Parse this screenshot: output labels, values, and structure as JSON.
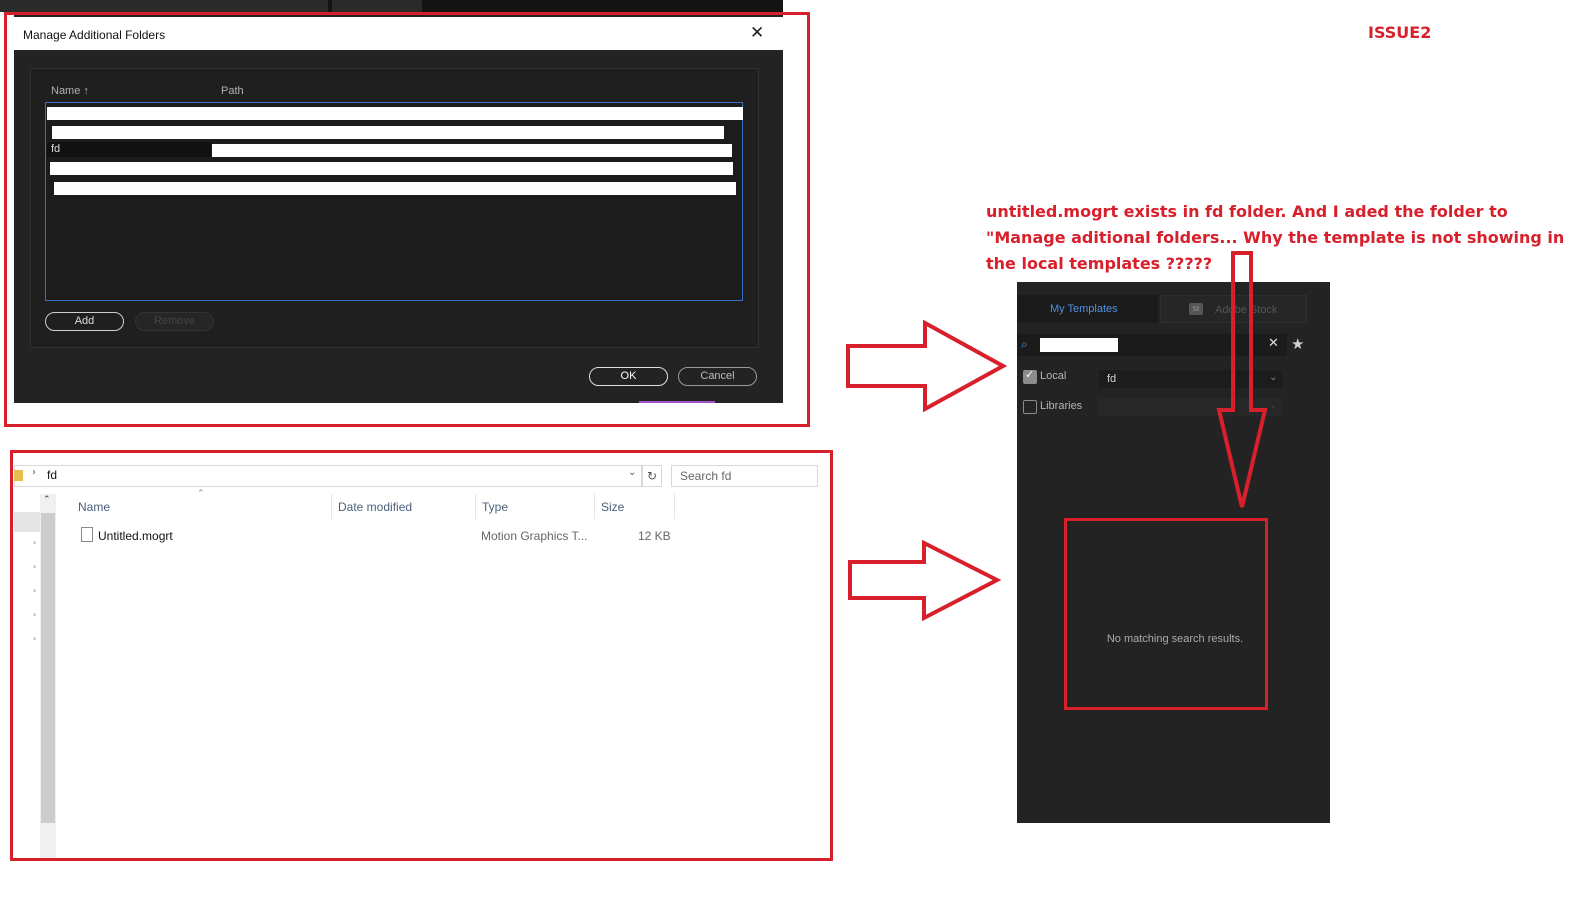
{
  "issue_label": "ISSUE2",
  "annotation_text": {
    "line1": "untitled.mogrt exists in fd folder. And I aded the folder to",
    "line2": "\"Manage aditional folders...  Why the template is not showing in",
    "line3": "the local templates ?????"
  },
  "dialog": {
    "title": "Manage Additional Folders",
    "close_label": "✕",
    "columns": {
      "name": "Name ↑",
      "path": "Path"
    },
    "selected_row_name": "fd",
    "add_label": "Add",
    "remove_label": "Remove",
    "ok_label": "OK",
    "cancel_label": "Cancel"
  },
  "explorer": {
    "breadcrumb": "fd",
    "search_placeholder": "Search fd",
    "columns": {
      "name": "Name",
      "date": "Date modified",
      "type": "Type",
      "size": "Size"
    },
    "files": [
      {
        "name": "Untitled.mogrt",
        "type": "Motion Graphics T...",
        "size": "12 KB"
      }
    ]
  },
  "templates_panel": {
    "tab_my_templates": "My Templates",
    "tab_adobe_stock": "Adobe Stock",
    "stock_badge": "St",
    "local_label": "Local",
    "local_checked": true,
    "local_folder": "fd",
    "libraries_label": "Libraries",
    "libraries_checked": false,
    "no_results": "No matching search results."
  },
  "colors": {
    "annotation_red": "#d8202c",
    "accent_blue": "#4a90e2"
  }
}
